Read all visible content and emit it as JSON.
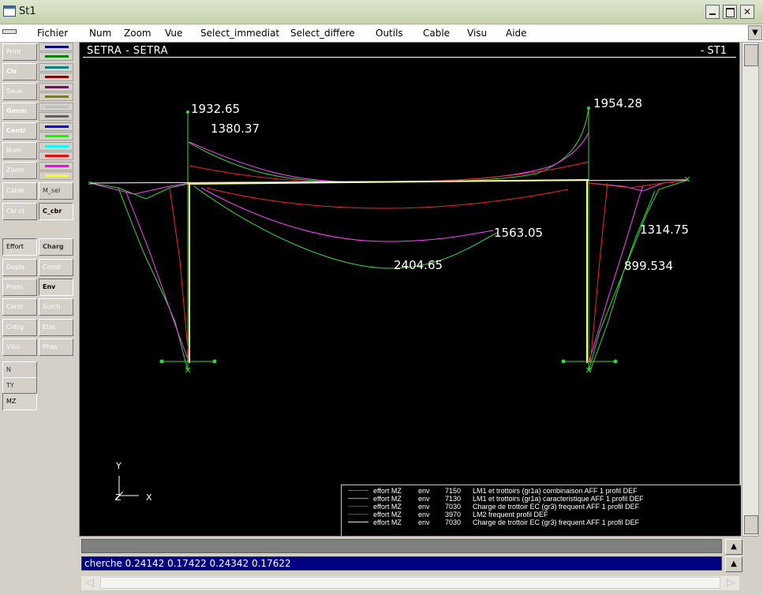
{
  "window": {
    "title": "St1"
  },
  "menu": [
    "Fichier",
    "Num",
    "Zoom",
    "Vue",
    "Select_immediat",
    "Select_differe",
    "Outils",
    "Cable",
    "Visu",
    "Aide"
  ],
  "left_buttons": [
    {
      "label": "Print"
    },
    {
      "label": "Cls"
    },
    {
      "label": "Sauv"
    },
    {
      "label": "Geom"
    },
    {
      "label": "Centr"
    },
    {
      "label": "Num"
    },
    {
      "label": "Zoom"
    },
    {
      "label": "Cable"
    },
    {
      "label": "Cbl ct"
    }
  ],
  "right_buttons": [
    {
      "label": "M_sel"
    },
    {
      "label": "C_cbr"
    }
  ],
  "swatches": [
    "#000080",
    "#008000",
    "#008080",
    "#800000",
    "#800080",
    "#808000",
    "#c0c0c0",
    "#606060",
    "#0000ff",
    "#00ff00",
    "#00ffff",
    "#ff0000",
    "#ff00ff",
    "#ffff00"
  ],
  "mode_buttons_left": [
    {
      "label": "Effort"
    },
    {
      "label": "Depla"
    },
    {
      "label": "Press"
    },
    {
      "label": "Contr"
    },
    {
      "label": "Cntrg"
    },
    {
      "label": "Visu"
    }
  ],
  "mode_buttons_right": [
    {
      "label": "Charg"
    },
    {
      "label": "Comb"
    },
    {
      "label": "Env"
    },
    {
      "label": "Surch"
    },
    {
      "label": "Etat"
    },
    {
      "label": "Phas"
    }
  ],
  "component_buttons": [
    {
      "label": "N"
    },
    {
      "label": "TY"
    },
    {
      "label": "MZ"
    }
  ],
  "canvas": {
    "title": "SETRA  -  SETRA",
    "right_label": "-  ST1",
    "axis_y": "Y",
    "axis_x": "X",
    "axis_z": "Z"
  },
  "value_labels": [
    "1932.65",
    "1380.37",
    "1954.28",
    "1563.05",
    "2404.65",
    "1314.75",
    "899.534"
  ],
  "legend": [
    {
      "color": "#ff00ff",
      "col1": "effort MZ",
      "col2": "env",
      "col3": "7150",
      "col4": "LM1 et trottoirs (gr1a) combinaison AFF 1 profil DEF"
    },
    {
      "color": "#00ff00",
      "col1": "effort MZ",
      "col2": "env",
      "col3": "7130",
      "col4": "LM1 et trottoirs (gr1a) caracteristique AFF 1 profil DEF"
    },
    {
      "color": "#ff0000",
      "col1": "effort MZ",
      "col2": "env",
      "col3": "7030",
      "col4": "Charge de trottoir EC (gr3) frequent AFF 1 profil DEF"
    },
    {
      "color": "#ff0000",
      "col1": "effort MZ",
      "col2": "env",
      "col3": "3970",
      "col4": "LM2 frequent profil DEF"
    },
    {
      "color": "#ffff00",
      "col1": "effort MZ",
      "col2": "env",
      "col3": "7030",
      "col4": "Charge de trottoir EC (gr3) frequent AFF 1 profil DEF"
    }
  ],
  "command_line": "cherche  0.24142  0.17422  0.24342  0.17622"
}
